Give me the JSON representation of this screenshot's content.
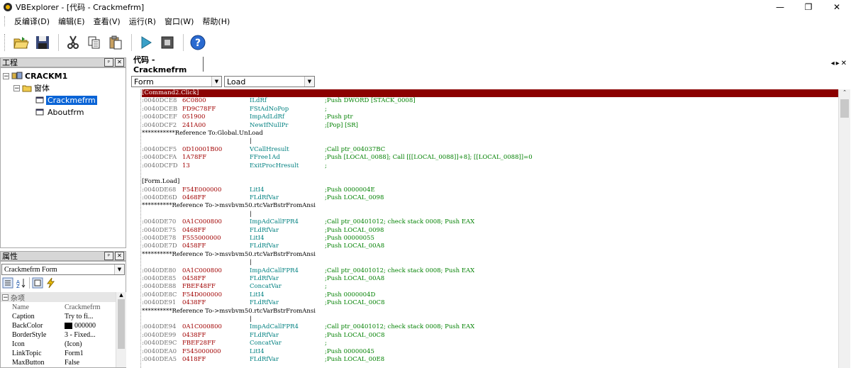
{
  "window": {
    "title": "VBExplorer - [代码 - Crackmefrm]",
    "controls": [
      "—",
      "❐",
      "✕"
    ]
  },
  "menu": [
    "反编译(D)",
    "编辑(E)",
    "查看(V)",
    "运行(R)",
    "窗口(W)",
    "帮助(H)"
  ],
  "toolbar": [
    "open-folder-icon",
    "save-icon",
    "cut-icon",
    "copy-icon",
    "paste-icon",
    "run-icon",
    "stop-icon",
    "help-icon"
  ],
  "project_panel": {
    "title": "工程",
    "tree": {
      "root": "CRACKM1",
      "folder": "窗体",
      "items": [
        "Crackmefrm",
        "Aboutfrm"
      ],
      "selected": "Crackmefrm"
    }
  },
  "properties_panel": {
    "title": "属性",
    "object_combo": "Crackmefrm   Form",
    "category": "杂项",
    "rows": [
      {
        "name": "Name",
        "value": "Crackmefrm"
      },
      {
        "name": "Caption",
        "value": "Try to fi..."
      },
      {
        "name": "BackColor",
        "value": "000000"
      },
      {
        "name": "BorderStyle",
        "value": "3 - Fixed..."
      },
      {
        "name": "Icon",
        "value": "(Icon)"
      },
      {
        "name": "LinkTopic",
        "value": "Form1"
      },
      {
        "name": "MaxButton",
        "value": "False"
      }
    ],
    "header_cols": [
      "Name",
      "Crackmefrm"
    ]
  },
  "code_window": {
    "tab": "代码 - Crackmefrm",
    "object_combo": "Form",
    "proc_combo": "Load",
    "lines": [
      {
        "t": "hl",
        "text": "[Command2.Click]"
      },
      {
        "a": ":0040DCE8",
        "h": "6C0800",
        "o": "ILdRf",
        "c": ";Push DWORD [STACK_0008]"
      },
      {
        "a": ":0040DCEB",
        "h": "FD9C78FF",
        "o": "FStAdNoPop",
        "c": ";"
      },
      {
        "a": ":0040DCEF",
        "h": "051900",
        "o": "ImpAdLdRf",
        "c": ";Push ptr"
      },
      {
        "a": ":0040DCF2",
        "h": "241A00",
        "o": "NewIfNullPr",
        "c": ";[Pop] [SR]"
      },
      {
        "t": "plain",
        "text": "***********Reference To:Global.UnLoad"
      },
      {
        "t": "bar",
        "text": "|"
      },
      {
        "a": ":0040DCF5",
        "h": "0D10001B00",
        "o": "VCallHresult",
        "c": ";Call ptr_004037BC"
      },
      {
        "a": ":0040DCFA",
        "h": "1A78FF",
        "o": "FFree1Ad",
        "c": ";Push [LOCAL_0088]; Call [[[LOCAL_0088]]+8]; [[LOCAL_0088]]=0"
      },
      {
        "a": ":0040DCFD",
        "h": "13",
        "o": "ExitProcHresult",
        "c": ";"
      },
      {
        "t": "plain",
        "text": ""
      },
      {
        "t": "plain",
        "text": "[Form.Load]"
      },
      {
        "a": ":0040DE68",
        "h": "F54E000000",
        "o": "LitI4",
        "c": ";Push 0000004E"
      },
      {
        "a": ":0040DE6D",
        "h": "0468FF",
        "o": "FLdRfVar",
        "c": ";Push LOCAL_0098"
      },
      {
        "t": "plain",
        "text": "**********Reference To->msvbvm50.rtcVarBstrFromAnsi"
      },
      {
        "t": "bar",
        "text": "|"
      },
      {
        "a": ":0040DE70",
        "h": "0A1C000800",
        "o": "ImpAdCallFPR4",
        "c": ";Call ptr_00401012; check stack 0008; Push EAX"
      },
      {
        "a": ":0040DE75",
        "h": "0468FF",
        "o": "FLdRfVar",
        "c": ";Push LOCAL_0098"
      },
      {
        "a": ":0040DE78",
        "h": "F555000000",
        "o": "LitI4",
        "c": ";Push 00000055"
      },
      {
        "a": ":0040DE7D",
        "h": "0458FF",
        "o": "FLdRfVar",
        "c": ";Push LOCAL_00A8"
      },
      {
        "t": "plain",
        "text": "**********Reference To->msvbvm50.rtcVarBstrFromAnsi"
      },
      {
        "t": "bar",
        "text": "|"
      },
      {
        "a": ":0040DE80",
        "h": "0A1C000800",
        "o": "ImpAdCallFPR4",
        "c": ";Call ptr_00401012; check stack 0008; Push EAX"
      },
      {
        "a": ":0040DE85",
        "h": "0458FF",
        "o": "FLdRfVar",
        "c": ";Push LOCAL_00A8"
      },
      {
        "a": ":0040DE88",
        "h": "FBEF48FF",
        "o": "ConcatVar",
        "c": ";"
      },
      {
        "a": ":0040DE8C",
        "h": "F54D000000",
        "o": "LitI4",
        "c": ";Push 0000004D"
      },
      {
        "a": ":0040DE91",
        "h": "0438FF",
        "o": "FLdRfVar",
        "c": ";Push LOCAL_00C8"
      },
      {
        "t": "plain",
        "text": "**********Reference To->msvbvm50.rtcVarBstrFromAnsi"
      },
      {
        "t": "bar",
        "text": "|"
      },
      {
        "a": ":0040DE94",
        "h": "0A1C000800",
        "o": "ImpAdCallFPR4",
        "c": ";Call ptr_00401012; check stack 0008; Push EAX"
      },
      {
        "a": ":0040DE99",
        "h": "0438FF",
        "o": "FLdRfVar",
        "c": ";Push LOCAL_00C8"
      },
      {
        "a": ":0040DE9C",
        "h": "FBEF28FF",
        "o": "ConcatVar",
        "c": ";"
      },
      {
        "a": ":0040DEA0",
        "h": "F545000000",
        "o": "LitI4",
        "c": ";Push 00000045"
      },
      {
        "a": ":0040DEA5",
        "h": "0418FF",
        "o": "FLdRfVar",
        "c": ";Push LOCAL_00E8"
      }
    ]
  }
}
